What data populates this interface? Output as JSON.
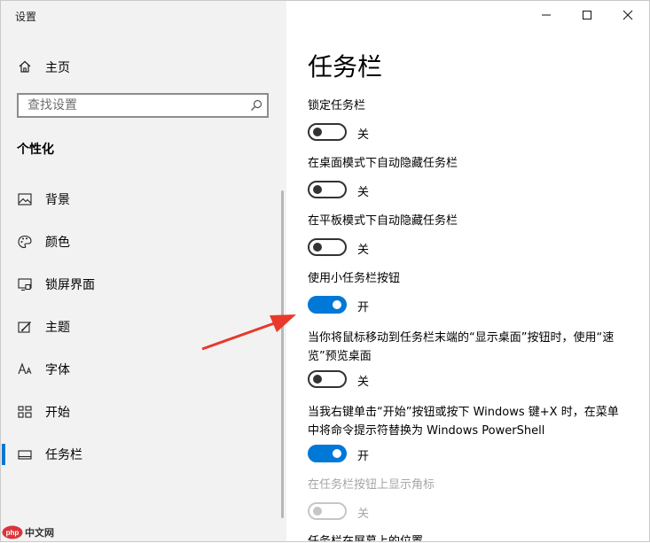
{
  "window": {
    "title": "设置"
  },
  "sidebar": {
    "home_label": "主页",
    "search_placeholder": "查找设置",
    "section_title": "个性化",
    "items": [
      {
        "label": "背景",
        "icon": "picture-icon"
      },
      {
        "label": "颜色",
        "icon": "palette-icon"
      },
      {
        "label": "锁屏界面",
        "icon": "lock-screen-icon"
      },
      {
        "label": "主题",
        "icon": "theme-brush-icon"
      },
      {
        "label": "字体",
        "icon": "font-icon"
      },
      {
        "label": "开始",
        "icon": "start-grid-icon"
      },
      {
        "label": "任务栏",
        "icon": "taskbar-icon",
        "active": true
      }
    ]
  },
  "main": {
    "title": "任务栏",
    "settings": [
      {
        "label": "锁定任务栏",
        "state": "关",
        "on": false
      },
      {
        "label": "在桌面模式下自动隐藏任务栏",
        "state": "关",
        "on": false
      },
      {
        "label": "在平板模式下自动隐藏任务栏",
        "state": "关",
        "on": false
      },
      {
        "label": "使用小任务栏按钮",
        "state": "开",
        "on": true
      },
      {
        "label": "当你将鼠标移动到任务栏末端的“显示桌面”按钮时，使用“速览”预览桌面",
        "state": "关",
        "on": false
      },
      {
        "label": "当我右键单击“开始”按钮或按下 Windows 键+X 时，在菜单中将命令提示符替换为 Windows PowerShell",
        "state": "开",
        "on": true
      },
      {
        "label": "在任务栏按钮上显示角标",
        "state": "关",
        "on": false,
        "disabled": true
      }
    ],
    "partial_label": "任务栏在屏幕上的位置"
  },
  "colors": {
    "accent": "#0078d7",
    "arrow": "#e8392b",
    "sidebar_bg": "#f2f2f2"
  },
  "watermark": {
    "text": "中文网",
    "logo": "php"
  }
}
